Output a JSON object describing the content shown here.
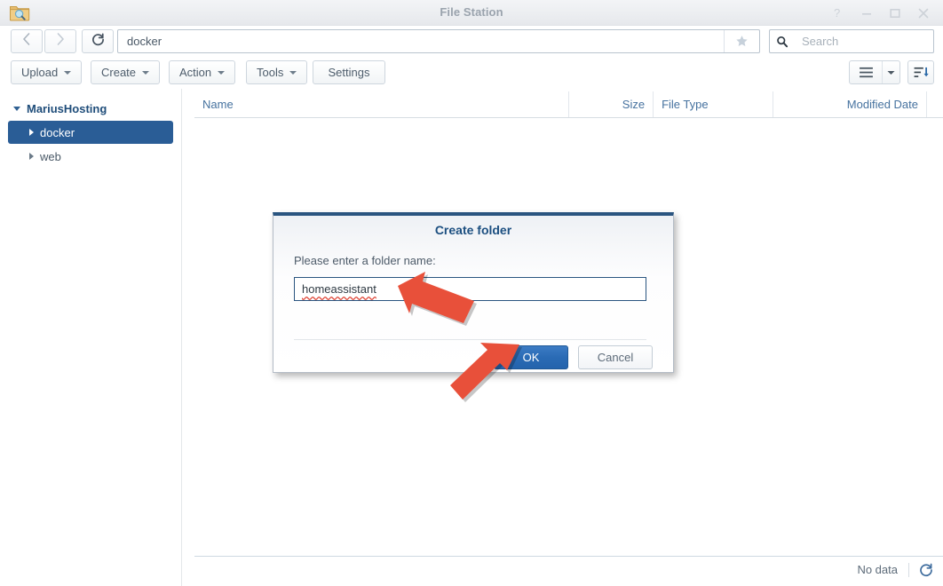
{
  "window": {
    "title": "File Station",
    "app_icon": "folder-search-icon",
    "controls": [
      {
        "name": "help",
        "glyph": "?"
      },
      {
        "name": "minimize",
        "glyph": "–"
      },
      {
        "name": "maximize",
        "glyph": "□"
      },
      {
        "name": "close",
        "glyph": "×"
      }
    ]
  },
  "nav": {
    "back_icon": "chevron-left-icon",
    "forward_icon": "chevron-right-icon",
    "reload_icon": "refresh-icon",
    "address_value": "docker",
    "favorite_icon": "star-icon",
    "search_placeholder": "Search",
    "search_icon": "search-icon"
  },
  "toolbar": {
    "buttons": [
      {
        "label": "Upload",
        "has_caret": true
      },
      {
        "label": "Create",
        "has_caret": true
      },
      {
        "label": "Action",
        "has_caret": true
      },
      {
        "label": "Tools",
        "has_caret": true
      },
      {
        "label": "Settings",
        "has_caret": false
      }
    ],
    "view_icon": "list-view-icon",
    "view_caret_icon": "chevron-down-icon",
    "sort_icon": "sort-descending-icon"
  },
  "sidebar": {
    "root": {
      "label": "MariusHosting",
      "expanded": true
    },
    "items": [
      {
        "label": "docker",
        "selected": true,
        "expanded": false
      },
      {
        "label": "web",
        "selected": false,
        "expanded": false
      }
    ]
  },
  "filelist": {
    "columns": [
      {
        "key": "name",
        "label": "Name"
      },
      {
        "key": "size",
        "label": "Size"
      },
      {
        "key": "filetype",
        "label": "File Type"
      },
      {
        "key": "modified",
        "label": "Modified Date"
      }
    ],
    "column_menu_icon": "more-vertical-icon",
    "rows": [],
    "status_text": "No data",
    "refresh_icon": "refresh-icon"
  },
  "dialog": {
    "title": "Create folder",
    "label": "Please enter a folder name:",
    "input_value": "homeassistant",
    "input_spellcheck_underline": true,
    "ok_label": "OK",
    "cancel_label": "Cancel"
  },
  "annotations": {
    "arrow_color": "#e8503a",
    "arrows": [
      {
        "name": "arrow-to-input",
        "target": "folder-name-input",
        "direction": "up-left"
      },
      {
        "name": "arrow-to-ok",
        "target": "ok-button",
        "direction": "up-right"
      }
    ]
  },
  "colors": {
    "accent_blue": "#2a5d96",
    "dialog_border_top": "#2a5580",
    "primary_button": "#2a6bb5",
    "header_text": "#46729f",
    "arrow_red": "#e8503a"
  }
}
